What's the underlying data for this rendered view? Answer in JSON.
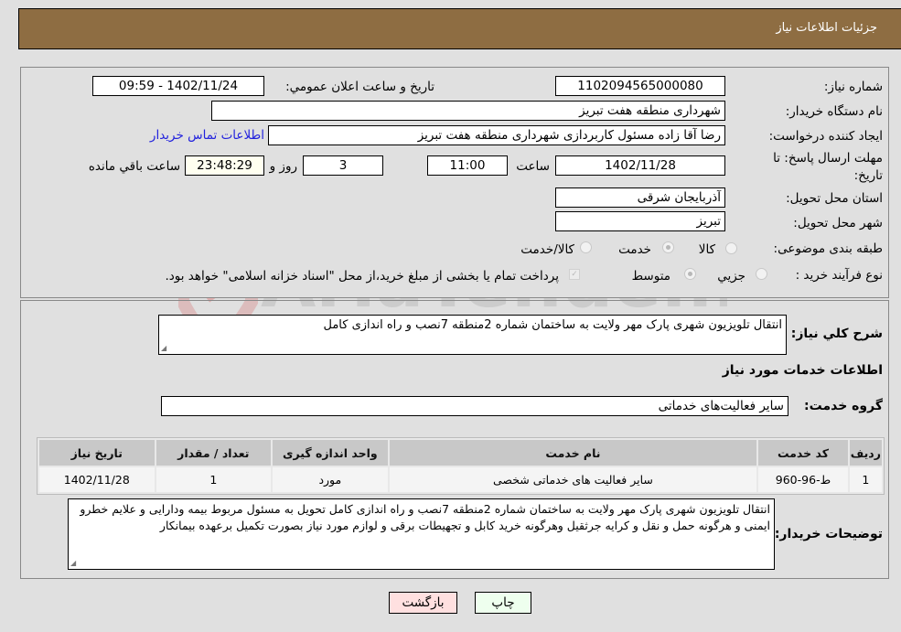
{
  "header": {
    "title": "جزئیات اطلاعات نیاز"
  },
  "form": {
    "need_number_label": "شماره نیاز:",
    "need_number": "1102094565000080",
    "announce_label": "تاریخ و ساعت اعلان عمومي:",
    "announce_value": "1402/11/24 - 09:59",
    "buyer_org_label": "نام دستگاه خریدار:",
    "buyer_org": "شهرداری منطقه هفت تبریز",
    "creator_label": "ایجاد کننده درخواست:",
    "creator": "رضا آقا زاده مسئول کاربردازی شهرداری منطقه هفت تبریز",
    "contact_link": "اطلاعات تماس خریدار",
    "deadline_label": "مهلت ارسال پاسخ: تا تاریخ:",
    "deadline_date": "1402/11/28",
    "time_label": "ساعت",
    "deadline_time": "11:00",
    "days": "3",
    "days_label": "روز و",
    "remaining": "23:48:29",
    "remaining_label": "ساعت باقي مانده",
    "province_label": "استان محل تحویل:",
    "province": "آذربایجان شرقی",
    "city_label": "شهر محل تحویل:",
    "city": "تبریز",
    "category_label": "طبقه بندی موضوعی:",
    "category_options": [
      "کالا",
      "خدمت",
      "کالا/خدمت"
    ],
    "category_selected": "خدمت",
    "process_label": "نوع فرآیند خرید :",
    "process_options": [
      "جزيي",
      "متوسط"
    ],
    "process_selected": "متوسط",
    "treasury_note": "پرداخت تمام یا بخشی از مبلغ خرید،از محل \"اسناد خزانه اسلامی\" خواهد بود."
  },
  "details": {
    "summary_label": "شرح کلي نیاز:",
    "summary": "انتقال تلویزیون شهری پارک مهر ولایت به  ساختمان شماره 2منطقه 7نصب و راه اندازی کامل",
    "services_heading": "اطلاعات خدمات مورد نیاز",
    "service_group_label": "گروه خدمت:",
    "service_group": "سایر فعالیت‌های خدماتی",
    "table": {
      "headers": [
        "ردیف",
        "کد خدمت",
        "نام خدمت",
        "واحد اندازه گیری",
        "تعداد / مقدار",
        "تاریخ نیاز"
      ],
      "rows": [
        [
          "1",
          "ط-96-960",
          "سایر فعالیت های خدماتی شخصی",
          "مورد",
          "1",
          "1402/11/28"
        ]
      ]
    },
    "buyer_notes_label": "توضیحات خریدار:",
    "buyer_notes": "انتقال تلویزیون شهری پارک مهر ولایت به  ساختمان شماره 2منطقه 7نصب و راه اندازی کامل تحویل به مسئول مربوط بیمه ودارایی و علایم خطرو ایمنی و هرگونه حمل و نقل و کرایه جرثقیل وهرگونه خرید کابل و تجهیطات برقی و لوازم مورد نیاز بصورت تکمیل برعهده بیمانکار"
  },
  "buttons": {
    "print": "چاپ",
    "back": "بازگشت"
  },
  "watermark": {
    "text": "AriaTender.neT"
  },
  "colors": {
    "header_bg": "#8e6d42",
    "back_btn": "#ffe0e0",
    "print_btn": "#eeffee",
    "link": "#2222dd"
  }
}
